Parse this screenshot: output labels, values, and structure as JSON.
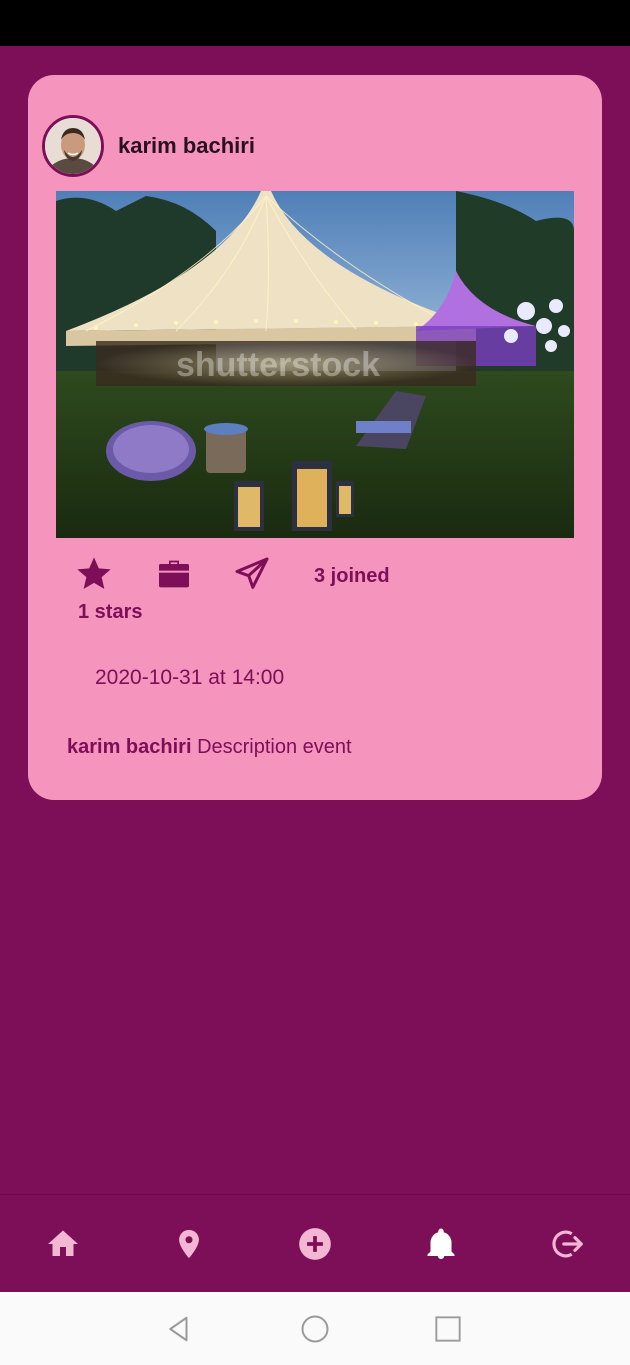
{
  "post": {
    "author": "karim bachiri",
    "joined_text": "3 joined",
    "stars_text": "1 stars",
    "datetime": "2020-10-31 at 14:00",
    "description": "Description event",
    "photo_alt": "Outdoor event tents at dusk",
    "watermark": "shutterstock"
  },
  "icons": {
    "star": "star-icon",
    "briefcase": "briefcase-icon",
    "send": "send-icon",
    "home": "home-icon",
    "location": "location-pin-icon",
    "add": "add-circle-icon",
    "notifications": "bell-icon",
    "logout": "logout-icon"
  },
  "colors": {
    "background": "#7d0e58",
    "card": "#f595bd",
    "accent": "#7d0e58",
    "nav_icon": "#f3b7d3",
    "nav_icon_active": "#ffffff"
  }
}
